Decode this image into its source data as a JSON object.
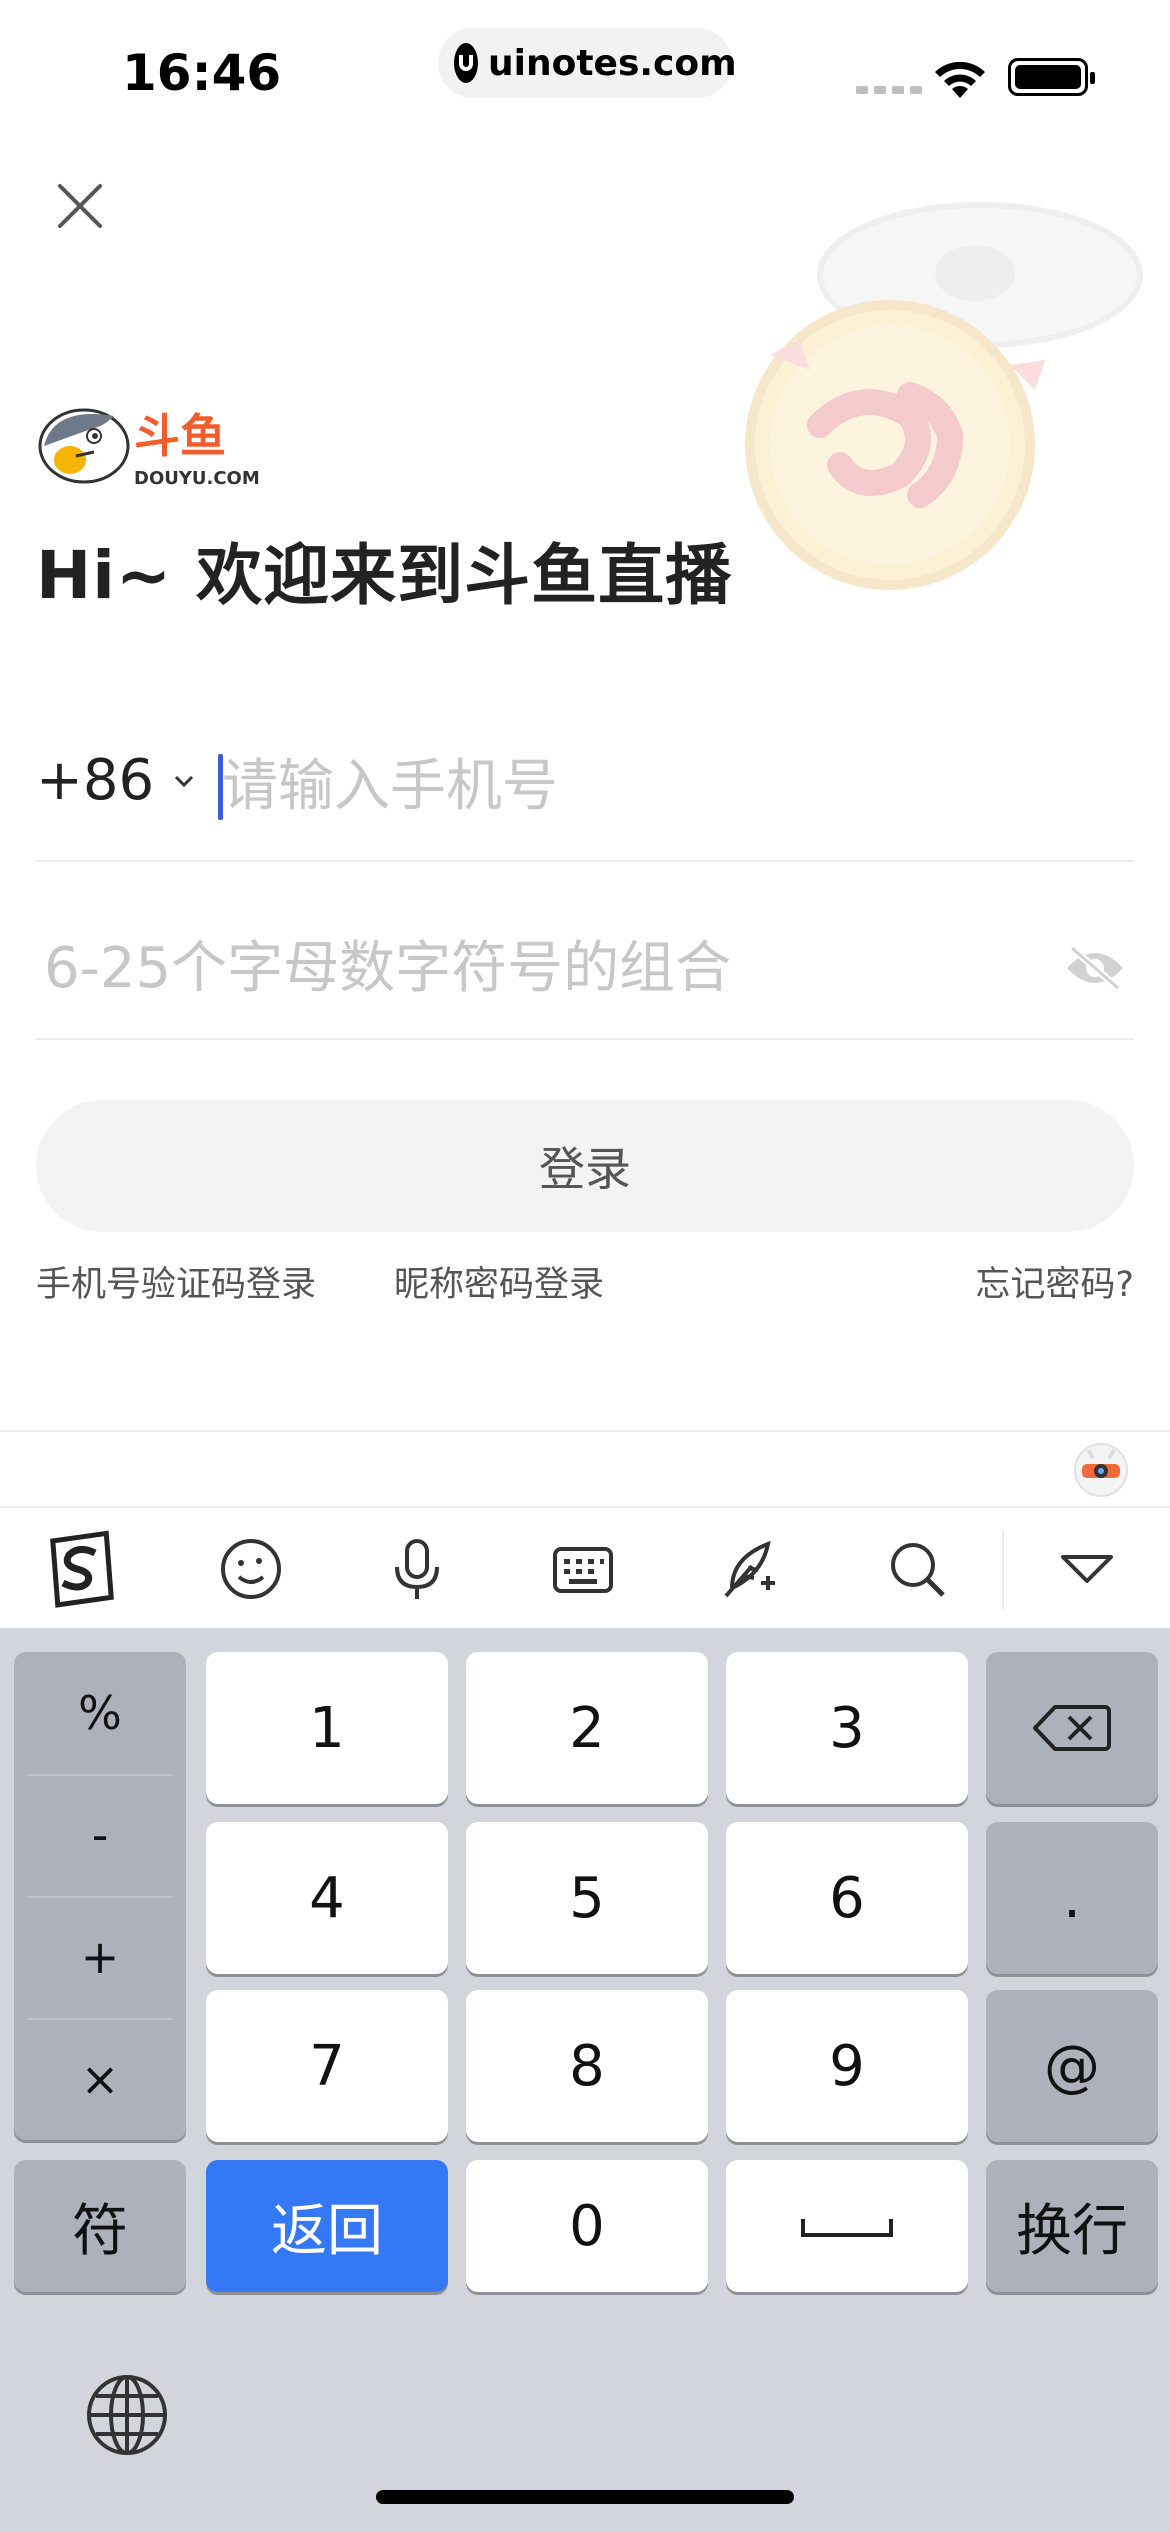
{
  "status_bar": {
    "time": "16:46",
    "url": "uinotes.com"
  },
  "logo": {
    "text_cn": "斗鱼",
    "text_en": "DOUYU.COM"
  },
  "welcome": "Hi~ 欢迎来到斗鱼直播",
  "phone": {
    "country_code": "+86",
    "placeholder": "请输入手机号",
    "value": ""
  },
  "password": {
    "placeholder": "6-25个字母数字符号的组合",
    "value": ""
  },
  "login_button": "登录",
  "links": {
    "sms_login": "手机号验证码登录",
    "nickname_login": "昵称密码登录",
    "forgot_password": "忘记密码?"
  },
  "keyboard": {
    "toolbar_icons": [
      "sogou-logo-icon",
      "emoji-icon",
      "microphone-icon",
      "keyboard-icon",
      "quill-icon",
      "search-icon",
      "collapse-icon"
    ],
    "symbols": [
      "%",
      "-",
      "+",
      "×"
    ],
    "digits": [
      "1",
      "2",
      "3",
      "4",
      "5",
      "6",
      "7",
      "8",
      "9",
      "0"
    ],
    "dot": ".",
    "at": "@",
    "symbol_key": "符",
    "return_key": "返回",
    "newline_key": "换行",
    "accent_color": "#3478f6"
  }
}
